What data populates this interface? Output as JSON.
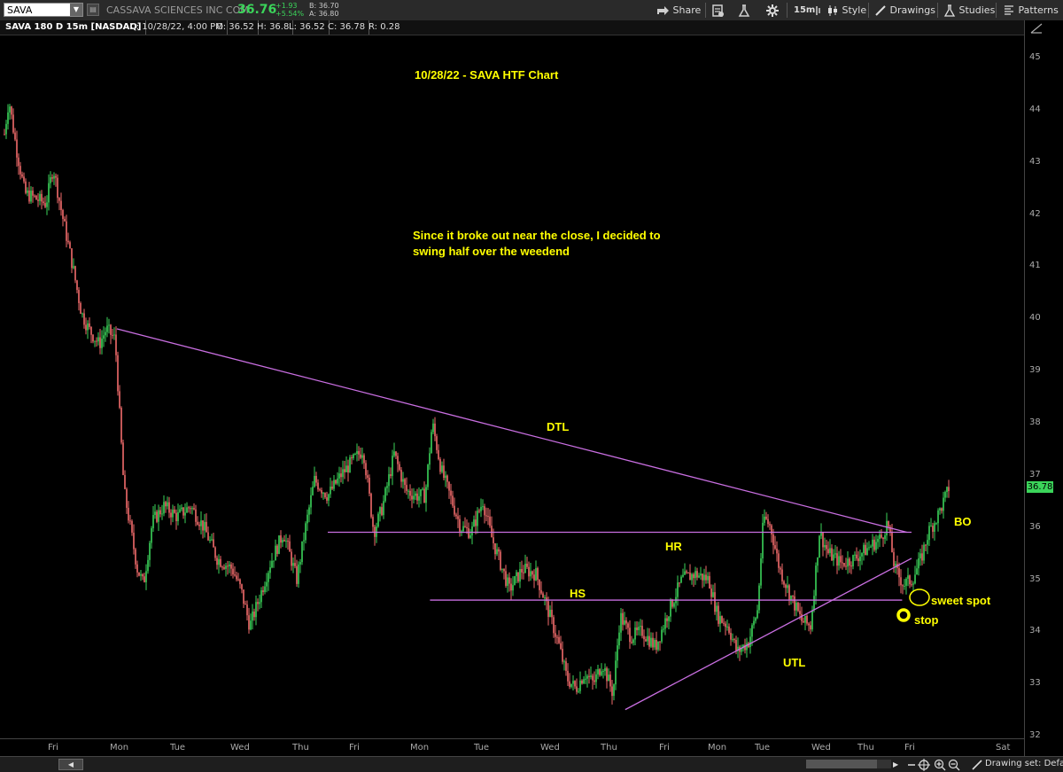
{
  "toolbar": {
    "symbol": "SAVA",
    "company": "CASSAVA SCIENCES INC COM",
    "last": "36.76",
    "change_abs": "+1.93",
    "change_pct": "+5.54%",
    "bid": "B: 36.70",
    "ask": "A: 36.80",
    "share_label": "Share",
    "timeframe_label": "15m",
    "style_label": "Style",
    "drawings_label": "Drawings",
    "studies_label": "Studies",
    "patterns_label": "Patterns"
  },
  "infobar": {
    "title": "SAVA 180 D 15m [NASDAQ]",
    "date": "D: 10/28/22, 4:00 PM",
    "open": "O: 36.52",
    "high": "H: 36.8",
    "low": "L: 36.52",
    "close": "C: 36.78",
    "range": "R: 0.28"
  },
  "price_axis": {
    "labels": [
      "45",
      "44",
      "43",
      "42",
      "41",
      "40",
      "39",
      "38",
      "37",
      "36",
      "35",
      "34",
      "33",
      "32"
    ],
    "last_tag": "36.78"
  },
  "time_axis": {
    "labels": [
      "Fri",
      "Mon",
      "Tue",
      "Wed",
      "Thu",
      "Fri",
      "Mon",
      "Tue",
      "Wed",
      "Thu",
      "Fri",
      "Mon",
      "Tue",
      "Wed",
      "Thu",
      "Fri",
      "Sat"
    ]
  },
  "annotations": {
    "title": "10/28/22 - SAVA HTF Chart",
    "note_line1": "Since it broke out near the close, I decided to",
    "note_line2": "swing half over the weedend",
    "dtl": "DTL",
    "hr": "HR",
    "hs": "HS",
    "utl": "UTL",
    "bo": "BO",
    "sweet_spot": "sweet spot",
    "stop": "stop"
  },
  "bottombar": {
    "drawing_set": "Drawing set: Default"
  },
  "colors": {
    "up": "#3bd45a",
    "down": "#f26c6c",
    "trendline": "#c86ee0",
    "annotation": "#ffff00"
  },
  "chart_data": {
    "type": "candlestick",
    "symbol": "SAVA",
    "ylim": [
      32,
      45.5
    ],
    "x": [
      "Fri",
      "Mon",
      "Tue",
      "Wed",
      "Thu",
      "Fri",
      "Mon",
      "Tue",
      "Wed",
      "Thu",
      "Fri",
      "Mon",
      "Tue",
      "Wed",
      "Thu",
      "Fri",
      "Sat"
    ],
    "price_path": [
      [
        0,
        44.8
      ],
      [
        4,
        43.4
      ],
      [
        10,
        44.2
      ],
      [
        18,
        43.3
      ],
      [
        28,
        42.4
      ],
      [
        40,
        42.3
      ],
      [
        52,
        42.2
      ],
      [
        60,
        42.9
      ],
      [
        70,
        42.0
      ],
      [
        82,
        41.0
      ],
      [
        92,
        40.1
      ],
      [
        100,
        39.8
      ],
      [
        112,
        39.5
      ],
      [
        120,
        39.8
      ],
      [
        130,
        39.6
      ],
      [
        140,
        36.7
      ],
      [
        155,
        35.2
      ],
      [
        162,
        34.9
      ],
      [
        172,
        36.1
      ],
      [
        185,
        36.4
      ],
      [
        200,
        36.2
      ],
      [
        215,
        36.4
      ],
      [
        230,
        36.0
      ],
      [
        245,
        35.4
      ],
      [
        262,
        35.2
      ],
      [
        272,
        34.8
      ],
      [
        282,
        34.1
      ],
      [
        292,
        34.6
      ],
      [
        305,
        35.3
      ],
      [
        320,
        35.9
      ],
      [
        335,
        35.0
      ],
      [
        345,
        36.0
      ],
      [
        355,
        36.9
      ],
      [
        370,
        36.6
      ],
      [
        385,
        37.0
      ],
      [
        400,
        37.3
      ],
      [
        410,
        37.5
      ],
      [
        422,
        35.9
      ],
      [
        432,
        36.4
      ],
      [
        445,
        37.4
      ],
      [
        458,
        36.7
      ],
      [
        470,
        36.6
      ],
      [
        480,
        36.6
      ],
      [
        488,
        38.0
      ],
      [
        498,
        37.1
      ],
      [
        510,
        36.5
      ],
      [
        520,
        36.0
      ],
      [
        532,
        35.9
      ],
      [
        545,
        36.5
      ],
      [
        555,
        35.8
      ],
      [
        565,
        35.3
      ],
      [
        575,
        34.8
      ],
      [
        590,
        35.2
      ],
      [
        605,
        35.1
      ],
      [
        615,
        34.6
      ],
      [
        630,
        33.8
      ],
      [
        640,
        33.1
      ],
      [
        650,
        32.9
      ],
      [
        660,
        33.2
      ],
      [
        670,
        33.0
      ],
      [
        680,
        33.4
      ],
      [
        692,
        32.8
      ],
      [
        700,
        34.3
      ],
      [
        712,
        33.9
      ],
      [
        725,
        34.0
      ],
      [
        740,
        33.7
      ],
      [
        755,
        34.4
      ],
      [
        770,
        35.0
      ],
      [
        785,
        35.1
      ],
      [
        800,
        35.0
      ],
      [
        810,
        34.3
      ],
      [
        822,
        34.1
      ],
      [
        832,
        33.6
      ],
      [
        845,
        33.8
      ],
      [
        855,
        34.4
      ],
      [
        862,
        36.2
      ],
      [
        870,
        36.0
      ],
      [
        880,
        35.2
      ],
      [
        892,
        34.7
      ],
      [
        905,
        34.2
      ],
      [
        915,
        34.1
      ],
      [
        925,
        35.9
      ],
      [
        935,
        35.5
      ],
      [
        950,
        35.3
      ],
      [
        965,
        35.4
      ],
      [
        980,
        35.6
      ],
      [
        995,
        35.8
      ],
      [
        1002,
        36.1
      ],
      [
        1010,
        35.2
      ],
      [
        1020,
        34.9
      ],
      [
        1030,
        35.0
      ],
      [
        1040,
        35.4
      ],
      [
        1048,
        35.9
      ],
      [
        1058,
        36.2
      ],
      [
        1068,
        36.6
      ],
      [
        1072,
        36.8
      ]
    ],
    "price_path_note": "",
    "trendlines": [
      {
        "name": "DTL",
        "from": [
          1,
          39.8
        ],
        "to": [
          14.9,
          35.9
        ]
      },
      {
        "name": "HR",
        "from": [
          4.5,
          35.9
        ],
        "to": [
          15,
          35.9
        ]
      },
      {
        "name": "HS",
        "from": [
          6.2,
          34.6
        ],
        "to": [
          14.8,
          34.6
        ]
      },
      {
        "name": "UTL",
        "from": [
          9.3,
          32.5
        ],
        "to": [
          15,
          35.4
        ]
      }
    ],
    "trendlines_x_note": ""
  }
}
